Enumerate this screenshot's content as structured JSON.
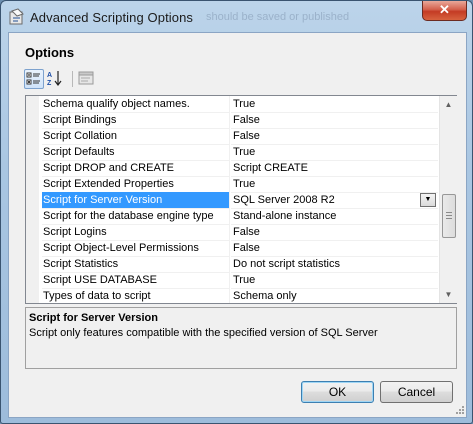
{
  "window": {
    "title": "Advanced Scripting Options",
    "background_title": "should be saved or published",
    "close_glyph": "✕"
  },
  "section_title": "Options",
  "toolbar": {
    "categorized_icon": "categorized-icon",
    "alphabetical_icon": "alphabetical-sort-icon",
    "property_pages_icon": "property-pages-icon"
  },
  "properties": [
    {
      "name": "Schema qualify object names.",
      "value": "True"
    },
    {
      "name": "Script Bindings",
      "value": "False"
    },
    {
      "name": "Script Collation",
      "value": "False"
    },
    {
      "name": "Script Defaults",
      "value": "True"
    },
    {
      "name": "Script DROP and CREATE",
      "value": "Script CREATE"
    },
    {
      "name": "Script Extended Properties",
      "value": "True"
    },
    {
      "name": "Script for Server Version",
      "value": "SQL Server 2008 R2"
    },
    {
      "name": "Script for the database engine type",
      "value": "Stand-alone instance"
    },
    {
      "name": "Script Logins",
      "value": "False"
    },
    {
      "name": "Script Object-Level Permissions",
      "value": "False"
    },
    {
      "name": "Script Statistics",
      "value": "Do not script statistics"
    },
    {
      "name": "Script USE DATABASE",
      "value": "True"
    },
    {
      "name": "Types of data to script",
      "value": "Schema only"
    }
  ],
  "selected_index": 6,
  "description": {
    "title": "Script for Server Version",
    "text": "Script only features compatible with the specified version of SQL Server"
  },
  "buttons": {
    "ok": "OK",
    "cancel": "Cancel"
  },
  "colors": {
    "selection": "#3399ff",
    "close_button": "#c43b24"
  }
}
